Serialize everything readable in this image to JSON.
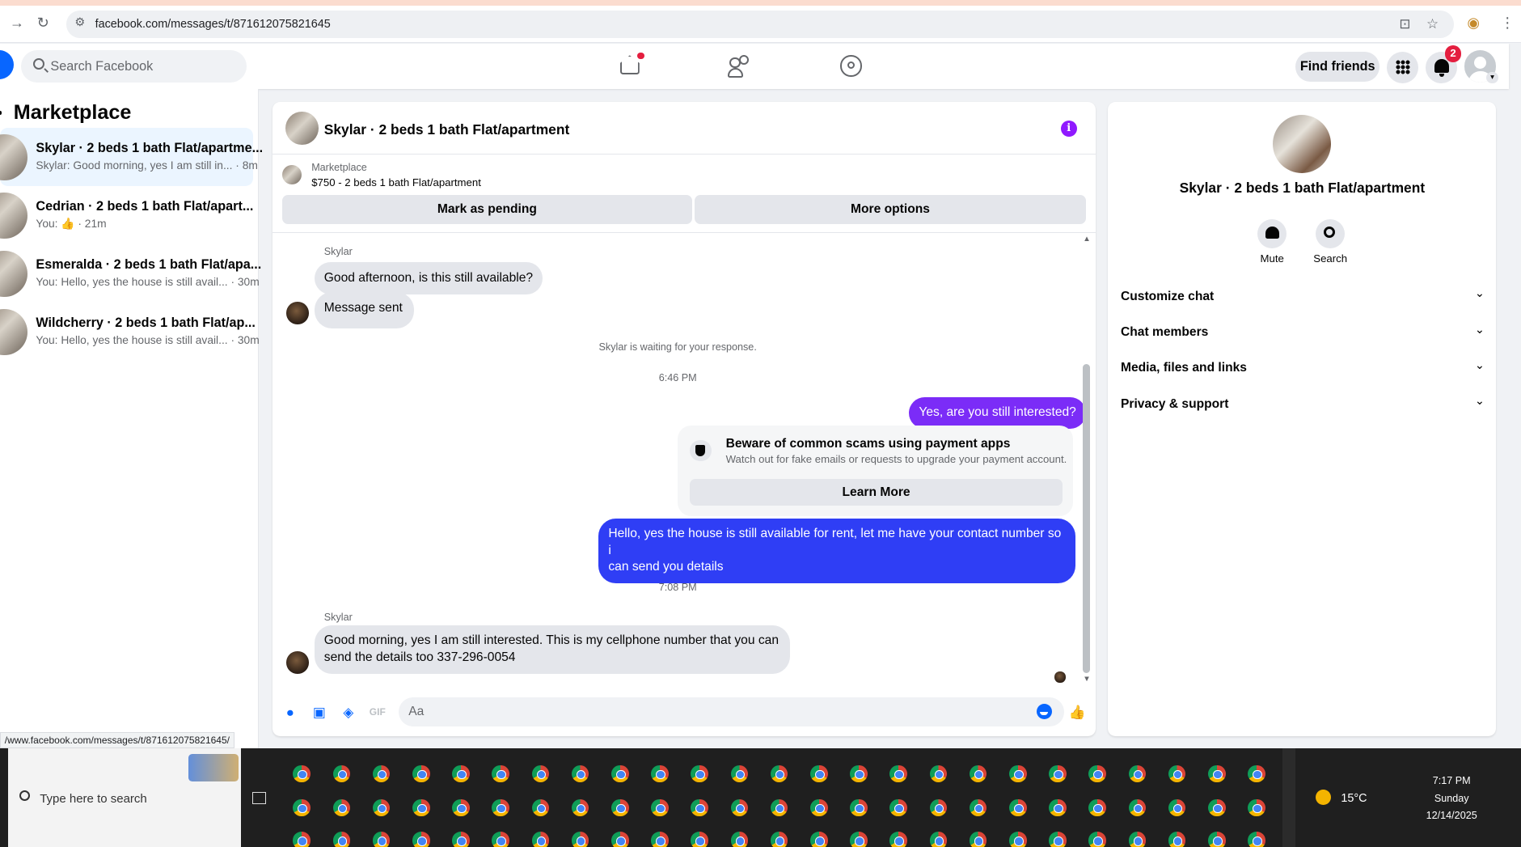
{
  "browser": {
    "url": "facebook.com/messages/t/871612075821645"
  },
  "fb": {
    "search_placeholder": "Search Facebook",
    "find_friends": "Find friends",
    "notif_count": "2"
  },
  "sidebar": {
    "title": "Marketplace",
    "conversations": [
      {
        "title": "Skylar · 2 beds 1 bath Flat/apartme...",
        "preview": "Skylar: Good morning, yes I am still in... · 8m"
      },
      {
        "title": "Cedrian · 2 beds 1 bath Flat/apart...",
        "preview_prefix": "You: ",
        "preview_suffix": " · 21m"
      },
      {
        "title": "Esmeralda · 2 beds 1 bath Flat/apa...",
        "preview": "You: Hello, yes the house is still avail... · 30m"
      },
      {
        "title": "Wildcherry · 2 beds 1 bath Flat/ap...",
        "preview": "You: Hello, yes the house is still avail... · 30m"
      }
    ],
    "status_url": "/www.facebook.com/messages/t/871612075821645/"
  },
  "chat": {
    "title": "Skylar · 2 beds 1 bath Flat/apartment",
    "marketplace_label": "Marketplace",
    "listing": "$750 - 2 beds 1 bath Flat/apartment",
    "mark_pending": "Mark as pending",
    "more_options": "More options",
    "sender1": "Skylar",
    "msg1": "Good afternoon, is this still available?",
    "msg2": "Message sent",
    "waiting": "Skylar is waiting for your response.",
    "time1": "6:46 PM",
    "out1": "Yes, are you still interested?",
    "scam_title": "Beware of common scams using payment apps",
    "scam_desc": "Watch out for fake emails or requests to upgrade your payment account.",
    "learn_more": "Learn More",
    "out2_line1": "Hello, yes the house is still available for rent, let me have your contact number so i",
    "out2_line2": "can send you details",
    "time2": "7:08 PM",
    "sender2": "Skylar",
    "msg3_line1": "Good morning, yes I am still interested. This is my cellphone number that you can",
    "msg3_line2": "send the details too 337-296-0054",
    "composer_placeholder": "Aa"
  },
  "details": {
    "title": "Skylar · 2 beds 1 bath Flat/apartment",
    "mute": "Mute",
    "search": "Search",
    "sections": [
      "Customize chat",
      "Chat members",
      "Media, files and links",
      "Privacy & support"
    ]
  },
  "taskbar": {
    "search_placeholder": "Type here to search",
    "temperature": "15°C",
    "time": "7:17 PM",
    "day": "Sunday",
    "date": "12/14/2025"
  }
}
